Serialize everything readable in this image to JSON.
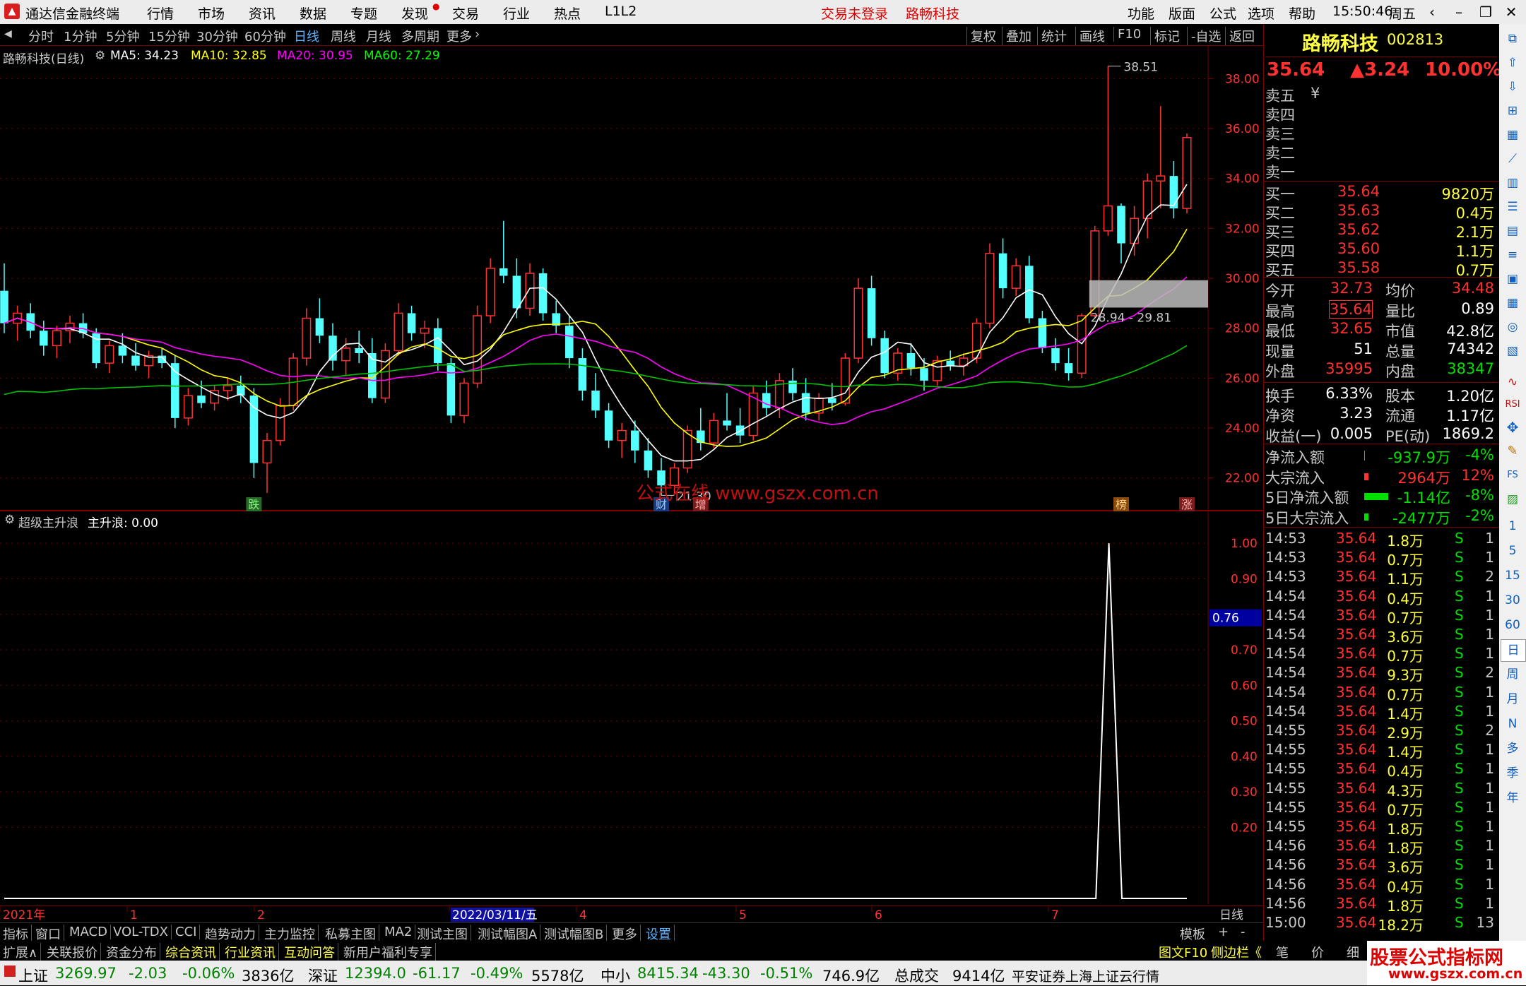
{
  "window": {
    "app_name": "通达信金融终端",
    "menus": [
      "行情",
      "市场",
      "资讯",
      "数据",
      "专题",
      "发现",
      "交易",
      "行业",
      "热点",
      "L1L2"
    ],
    "login_status": "交易未登录",
    "stock_title": "路畅科技",
    "right_menus": [
      "功能",
      "版面",
      "公式",
      "选项",
      "帮助"
    ],
    "time": "15:50:46",
    "weekday": "周五"
  },
  "periods": [
    "分时",
    "1分钟",
    "5分钟",
    "15分钟",
    "30分钟",
    "60分钟",
    "日线",
    "周线",
    "月线",
    "多周期",
    "更多"
  ],
  "active_period": "日线",
  "tools": [
    "复权",
    "叠加",
    "统计",
    "画线",
    "F10",
    "标记",
    "-自选",
    "返回"
  ],
  "chart_legend": {
    "name": "路畅科技(日线)",
    "ma5": "MA5: 34.23",
    "ma10": "MA10: 32.85",
    "ma20": "MA20: 30.95",
    "ma60": "MA60: 27.29"
  },
  "chart_data": [
    {
      "type": "candlestick",
      "title": "路畅科技(日线)",
      "y_ticks": [
        "38.00",
        "36.00",
        "34.00",
        "32.00",
        "30.00",
        "28.00",
        "26.00",
        "24.00",
        "22.00"
      ],
      "ylim": [
        21,
        39
      ],
      "x_labels": [
        "2021年",
        "1",
        "2",
        "2022/03/11/五",
        "4",
        "5",
        "6",
        "7"
      ],
      "annotations": {
        "high": "38.51",
        "low": "21.30",
        "zone": "28.94 - 29.81"
      },
      "markers": [
        "跌",
        "财",
        "增",
        "榜",
        "涨"
      ],
      "watermark": "公式在线 www.gszx.com.cn",
      "ohlc": [
        [
          29.5,
          30.6,
          27.8,
          28.2
        ],
        [
          28.2,
          28.9,
          27.5,
          28.6
        ],
        [
          28.6,
          29.0,
          27.6,
          27.9
        ],
        [
          27.9,
          28.3,
          26.9,
          27.3
        ],
        [
          27.3,
          28.1,
          26.8,
          27.9
        ],
        [
          27.9,
          28.5,
          27.4,
          28.2
        ],
        [
          28.2,
          28.6,
          27.6,
          27.8
        ],
        [
          27.8,
          28.0,
          26.4,
          26.6
        ],
        [
          26.6,
          27.5,
          26.2,
          27.3
        ],
        [
          27.3,
          27.8,
          26.6,
          26.9
        ],
        [
          26.9,
          27.4,
          26.3,
          26.5
        ],
        [
          26.5,
          27.1,
          26.0,
          26.9
        ],
        [
          26.9,
          27.2,
          26.4,
          26.6
        ],
        [
          26.6,
          26.9,
          24.0,
          24.4
        ],
        [
          24.4,
          25.6,
          24.1,
          25.3
        ],
        [
          25.3,
          25.9,
          24.8,
          25.0
        ],
        [
          25.0,
          25.7,
          24.7,
          25.5
        ],
        [
          25.5,
          26.0,
          25.1,
          25.7
        ],
        [
          25.7,
          26.1,
          25.0,
          25.3
        ],
        [
          25.3,
          25.6,
          22.0,
          22.6
        ],
        [
          22.6,
          23.8,
          21.4,
          23.5
        ],
        [
          23.5,
          25.2,
          23.3,
          24.9
        ],
        [
          24.9,
          27.0,
          24.7,
          26.8
        ],
        [
          26.8,
          28.8,
          26.5,
          28.4
        ],
        [
          28.4,
          29.2,
          27.4,
          27.7
        ],
        [
          27.7,
          28.2,
          26.3,
          26.7
        ],
        [
          26.7,
          27.6,
          26.1,
          27.2
        ],
        [
          27.2,
          27.9,
          26.6,
          27.0
        ],
        [
          27.0,
          27.6,
          25.0,
          25.2
        ],
        [
          25.2,
          27.4,
          25.0,
          27.1
        ],
        [
          27.1,
          29.0,
          26.9,
          28.6
        ],
        [
          28.6,
          28.9,
          27.5,
          27.8
        ],
        [
          27.8,
          28.3,
          27.2,
          28.0
        ],
        [
          28.0,
          28.4,
          26.3,
          26.6
        ],
        [
          26.6,
          26.8,
          24.2,
          24.5
        ],
        [
          24.5,
          26.0,
          24.2,
          25.8
        ],
        [
          25.8,
          28.9,
          25.6,
          28.5
        ],
        [
          28.5,
          30.8,
          28.2,
          30.4
        ],
        [
          30.4,
          32.3,
          29.8,
          30.1
        ],
        [
          30.1,
          30.8,
          28.4,
          28.8
        ],
        [
          28.8,
          30.6,
          28.5,
          30.2
        ],
        [
          30.2,
          30.4,
          28.3,
          28.6
        ],
        [
          28.6,
          29.1,
          27.8,
          28.1
        ],
        [
          28.1,
          28.5,
          26.4,
          26.8
        ],
        [
          26.8,
          27.2,
          25.1,
          25.5
        ],
        [
          25.5,
          26.2,
          24.4,
          24.7
        ],
        [
          24.7,
          25.0,
          23.2,
          23.5
        ],
        [
          23.5,
          24.2,
          22.8,
          23.9
        ],
        [
          23.9,
          24.3,
          22.6,
          23.1
        ],
        [
          23.1,
          23.6,
          22.0,
          22.3
        ],
        [
          22.3,
          22.8,
          21.3,
          21.7
        ],
        [
          21.7,
          22.6,
          21.3,
          22.4
        ],
        [
          22.4,
          24.1,
          22.2,
          23.9
        ],
        [
          23.9,
          24.8,
          23.1,
          23.4
        ],
        [
          23.4,
          24.6,
          23.2,
          24.3
        ],
        [
          24.3,
          25.4,
          23.9,
          24.1
        ],
        [
          24.1,
          24.8,
          23.4,
          23.7
        ],
        [
          23.7,
          25.7,
          23.5,
          25.4
        ],
        [
          25.4,
          25.9,
          24.5,
          24.8
        ],
        [
          24.8,
          26.2,
          24.4,
          25.9
        ],
        [
          25.9,
          26.4,
          25.1,
          25.4
        ],
        [
          25.4,
          26.0,
          24.3,
          24.6
        ],
        [
          24.6,
          25.4,
          24.3,
          25.2
        ],
        [
          25.2,
          25.8,
          24.7,
          25.0
        ],
        [
          25.0,
          27.0,
          24.9,
          26.8
        ],
        [
          26.8,
          30.0,
          26.6,
          29.6
        ],
        [
          29.6,
          30.1,
          27.3,
          27.6
        ],
        [
          27.6,
          27.9,
          26.0,
          26.2
        ],
        [
          26.2,
          27.2,
          25.9,
          27.0
        ],
        [
          27.0,
          27.4,
          26.1,
          26.4
        ],
        [
          26.4,
          26.8,
          25.5,
          25.9
        ],
        [
          25.9,
          26.9,
          25.7,
          26.7
        ],
        [
          26.7,
          27.1,
          26.3,
          26.5
        ],
        [
          26.5,
          27.0,
          26.1,
          26.8
        ],
        [
          26.8,
          28.4,
          26.6,
          28.2
        ],
        [
          28.2,
          31.4,
          28.0,
          31.0
        ],
        [
          31.0,
          31.6,
          29.2,
          29.6
        ],
        [
          29.6,
          30.8,
          29.3,
          30.5
        ],
        [
          30.5,
          30.9,
          28.2,
          28.4
        ],
        [
          28.4,
          28.7,
          27.0,
          27.2
        ],
        [
          27.2,
          27.6,
          26.3,
          26.6
        ],
        [
          26.6,
          27.2,
          25.9,
          26.2
        ],
        [
          26.2,
          28.6,
          26.0,
          28.5
        ],
        [
          28.5,
          32.1,
          28.4,
          31.9
        ],
        [
          31.9,
          38.5,
          31.7,
          32.9
        ],
        [
          32.9,
          33.0,
          30.6,
          31.4
        ],
        [
          31.4,
          32.9,
          30.9,
          32.4
        ],
        [
          32.4,
          34.2,
          31.6,
          33.9
        ],
        [
          33.9,
          36.9,
          32.8,
          34.1
        ],
        [
          34.1,
          34.7,
          32.4,
          32.8
        ],
        [
          32.8,
          35.8,
          32.6,
          35.64
        ]
      ]
    },
    {
      "type": "line",
      "title": "超级主升浪",
      "legend": "主升浪: 0.00",
      "y_ticks": [
        "1.00",
        "0.90",
        "0.80",
        "0.70",
        "0.60",
        "0.50",
        "0.40",
        "0.30",
        "0.20"
      ],
      "ylim": [
        0,
        1.05
      ],
      "current_marker": "0.76",
      "values": [
        0,
        0,
        0,
        0,
        0,
        0,
        0,
        0,
        0,
        0,
        0,
        0,
        0,
        0,
        0,
        0,
        0,
        0,
        0,
        0,
        0,
        0,
        0,
        0,
        0,
        0,
        0,
        0,
        0,
        0,
        0,
        0,
        0,
        0,
        0,
        0,
        0,
        0,
        0,
        0,
        0,
        0,
        0,
        0,
        0,
        0,
        0,
        0,
        0,
        0,
        0,
        0,
        0,
        0,
        0,
        0,
        0,
        0,
        0,
        0,
        0,
        0,
        0,
        0,
        0,
        0,
        0,
        0,
        0,
        0,
        0,
        0,
        0,
        0,
        0,
        0,
        0,
        0,
        0,
        0,
        0,
        0,
        0,
        0,
        0,
        1,
        0,
        0,
        0,
        0,
        0,
        0
      ]
    }
  ],
  "quote": {
    "name": "路畅科技",
    "code": "002813",
    "price": "35.64",
    "change": "▲3.24",
    "pct": "10.00%",
    "asks": [
      {
        "label": "卖五",
        "price": "",
        "vol": ""
      },
      {
        "label": "卖四",
        "price": "",
        "vol": ""
      },
      {
        "label": "卖三",
        "price": "",
        "vol": ""
      },
      {
        "label": "卖二",
        "price": "",
        "vol": ""
      },
      {
        "label": "卖一",
        "price": "",
        "vol": ""
      }
    ],
    "ask_symbol": "¥",
    "bids": [
      {
        "label": "买一",
        "price": "35.64",
        "vol": "9820万"
      },
      {
        "label": "买二",
        "price": "35.63",
        "vol": "0.4万"
      },
      {
        "label": "买三",
        "price": "35.62",
        "vol": "2.1万"
      },
      {
        "label": "买四",
        "price": "35.60",
        "vol": "1.1万"
      },
      {
        "label": "买五",
        "price": "35.58",
        "vol": "0.7万"
      }
    ],
    "stats": [
      {
        "l1": "今开",
        "v1": "32.73",
        "l2": "均价",
        "v2": "34.48"
      },
      {
        "l1": "最高",
        "v1": "35.64",
        "l2": "量比",
        "v2": "0.89"
      },
      {
        "l1": "最低",
        "v1": "32.65",
        "l2": "市值",
        "v2": "42.8亿"
      },
      {
        "l1": "现量",
        "v1": "51",
        "l2": "总量",
        "v2": "74342"
      },
      {
        "l1": "外盘",
        "v1": "35995",
        "l2": "内盘",
        "v2": "38347"
      }
    ],
    "stats2": [
      {
        "l1": "换手",
        "v1": "6.33%",
        "l2": "股本",
        "v2": "1.20亿"
      },
      {
        "l1": "净资",
        "v1": "3.23",
        "l2": "流通",
        "v2": "1.17亿"
      },
      {
        "l1": "收益(一)",
        "v1": "0.005",
        "l2": "PE(动)",
        "v2": "1869.2"
      }
    ],
    "flows": [
      {
        "l": "净流入额",
        "v": "-937.9万",
        "p": "-4%"
      },
      {
        "l": "大宗流入",
        "v": "2964万",
        "p": "12%"
      },
      {
        "l": "5日净流入额",
        "v": "-1.14亿",
        "p": "-8%"
      },
      {
        "l": "5日大宗流入",
        "v": "-2477万",
        "p": "-2%"
      }
    ],
    "ticks": [
      {
        "t": "14:53",
        "p": "35.64",
        "v": "1.8万",
        "s": "S",
        "n": "1"
      },
      {
        "t": "14:53",
        "p": "35.64",
        "v": "0.7万",
        "s": "S",
        "n": "1"
      },
      {
        "t": "14:53",
        "p": "35.64",
        "v": "1.1万",
        "s": "S",
        "n": "2"
      },
      {
        "t": "14:54",
        "p": "35.64",
        "v": "0.4万",
        "s": "S",
        "n": "1"
      },
      {
        "t": "14:54",
        "p": "35.64",
        "v": "0.7万",
        "s": "S",
        "n": "1"
      },
      {
        "t": "14:54",
        "p": "35.64",
        "v": "3.6万",
        "s": "S",
        "n": "1"
      },
      {
        "t": "14:54",
        "p": "35.64",
        "v": "0.7万",
        "s": "S",
        "n": "1"
      },
      {
        "t": "14:54",
        "p": "35.64",
        "v": "9.3万",
        "s": "S",
        "n": "2"
      },
      {
        "t": "14:54",
        "p": "35.64",
        "v": "0.7万",
        "s": "S",
        "n": "1"
      },
      {
        "t": "14:54",
        "p": "35.64",
        "v": "1.4万",
        "s": "S",
        "n": "1"
      },
      {
        "t": "14:55",
        "p": "35.64",
        "v": "2.9万",
        "s": "S",
        "n": "2"
      },
      {
        "t": "14:55",
        "p": "35.64",
        "v": "1.4万",
        "s": "S",
        "n": "1"
      },
      {
        "t": "14:55",
        "p": "35.64",
        "v": "0.4万",
        "s": "S",
        "n": "1"
      },
      {
        "t": "14:55",
        "p": "35.64",
        "v": "4.3万",
        "s": "S",
        "n": "1"
      },
      {
        "t": "14:55",
        "p": "35.64",
        "v": "0.7万",
        "s": "S",
        "n": "1"
      },
      {
        "t": "14:55",
        "p": "35.64",
        "v": "1.8万",
        "s": "S",
        "n": "1"
      },
      {
        "t": "14:56",
        "p": "35.64",
        "v": "1.8万",
        "s": "S",
        "n": "1"
      },
      {
        "t": "14:56",
        "p": "35.64",
        "v": "3.6万",
        "s": "S",
        "n": "1"
      },
      {
        "t": "14:56",
        "p": "35.64",
        "v": "0.4万",
        "s": "S",
        "n": "1"
      },
      {
        "t": "14:56",
        "p": "35.64",
        "v": "1.8万",
        "s": "S",
        "n": "1"
      },
      {
        "t": "15:00",
        "p": "35.64",
        "v": "18.2万",
        "s": "S",
        "n": "13"
      }
    ]
  },
  "sidebar_periods": [
    "1",
    "5",
    "15",
    "30",
    "60",
    "日",
    "周",
    "月",
    "N",
    "多",
    "季",
    "年"
  ],
  "sidebar_labels": [
    "RSI",
    "FS"
  ],
  "xaxis_right": "日线",
  "tabs1": [
    "指标",
    "窗口",
    "MACD",
    "VOL-TDX",
    "CCI",
    "趋势动力",
    "主力监控",
    "私募主图",
    "MA2",
    "测试主图",
    "测试幅图A",
    "测试幅图B",
    "更多",
    "设置"
  ],
  "tabs1_right": [
    "模板",
    "+",
    "-"
  ],
  "tabs2": [
    "扩展∧",
    "关联报价",
    "资金分布",
    "综合资讯",
    "行业资讯",
    "互动问答",
    "新用户福利专享"
  ],
  "tabs2_right": [
    "图文F10",
    "侧边栏《",
    "笔",
    "价",
    "细"
  ],
  "status": {
    "sh_label": "上证",
    "sh": "3269.97",
    "sh_chg": "-2.03",
    "sh_pct": "-0.06%",
    "sh_amt": "3836亿",
    "sz_label": "深证",
    "sz": "12394.0",
    "sz_chg": "-61.17",
    "sz_pct": "-0.49%",
    "sz_amt": "5578亿",
    "zx_label": "中小",
    "zx": "8415.34",
    "zx_chg": "-43.30",
    "zx_pct": "-0.51%",
    "zx_amt": "746.9亿",
    "total_label": "总成交",
    "total": "9414亿",
    "broker": "平安证券上海上证云行情"
  },
  "brand": {
    "line1": "股票公式指标网",
    "line2": "www.gszx.com.cn"
  },
  "colors": {
    "up": "#ff3232",
    "down": "#54ffff",
    "ma5": "#ffffff",
    "ma10": "#ffff00",
    "ma20": "#ff00ff",
    "ma60": "#00c000",
    "grid": "#7a0000"
  }
}
